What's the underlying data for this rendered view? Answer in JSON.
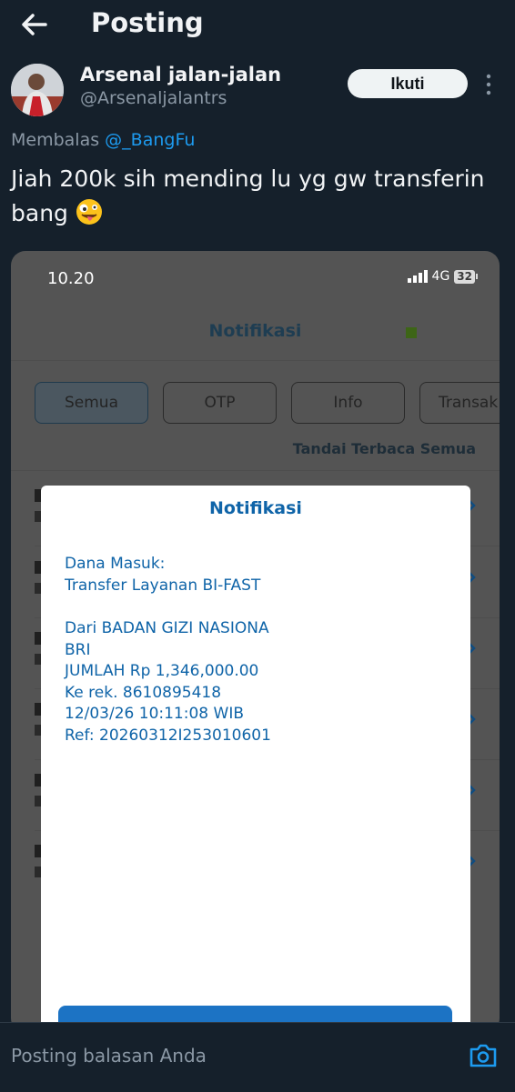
{
  "header": {
    "title": "Posting"
  },
  "tweet": {
    "author_name": "Arsenal jalan-jalan",
    "author_handle": "@Arsenaljalantrs",
    "follow_label": "Ikuti",
    "reply_prefix": "Membalas",
    "reply_mention": "@_BangFu",
    "text_line1": "Jiah 200k sih mending lu yg gw transferin",
    "text_line2": "bang"
  },
  "phone": {
    "time": "10.20",
    "network": "4G",
    "battery": "32",
    "screen_title": "Notifikasi",
    "tabs": [
      {
        "label": "Semua"
      },
      {
        "label": "OTP"
      },
      {
        "label": "Info"
      },
      {
        "label": "Transak"
      }
    ],
    "mark_all_read": "Tandai Terbaca Semua"
  },
  "modal": {
    "title": "Notifikasi",
    "line1": "Dana Masuk:",
    "line2": "Transfer Layanan BI-FAST",
    "line3": "Dari BADAN GIZI NASIONA",
    "line4": "BRI",
    "line5": "JUMLAH Rp 1,346,000.00",
    "line6": "Ke rek. 8610895418",
    "line7": "12/03/26 10:11:08 WIB",
    "line8": "Ref: 20260312I253010601"
  },
  "reply_bar": {
    "placeholder": "Posting balasan Anda"
  },
  "colors": {
    "background": "#15202b",
    "accent": "#1d9bf0",
    "bank_blue": "#0f64a8"
  }
}
